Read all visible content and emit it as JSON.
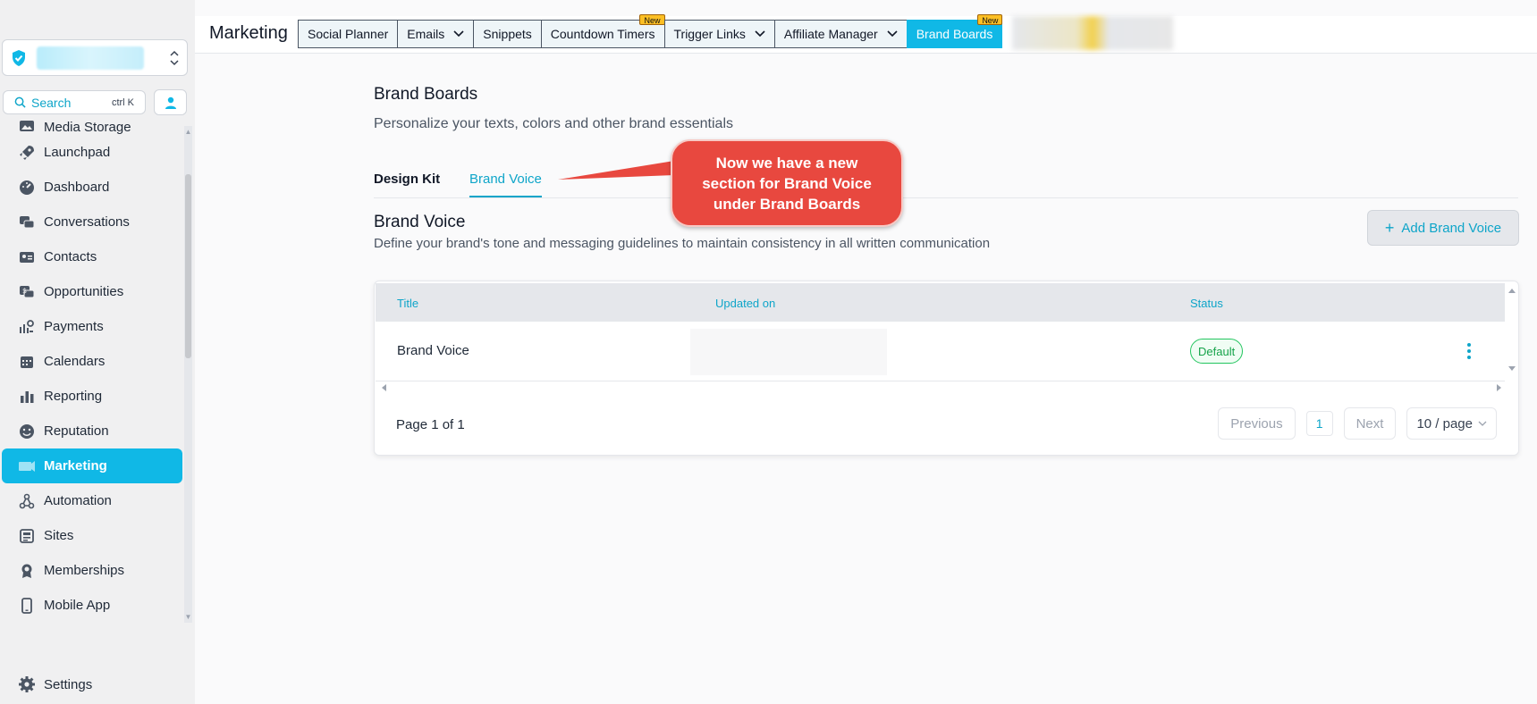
{
  "sidebar": {
    "search": {
      "label": "Search",
      "shortcut": "ctrl K"
    },
    "items": [
      {
        "label": "Media Storage",
        "icon": "image-icon",
        "active": false
      },
      {
        "label": "Launchpad",
        "icon": "rocket-icon",
        "active": false
      },
      {
        "label": "Dashboard",
        "icon": "gauge-icon",
        "active": false
      },
      {
        "label": "Conversations",
        "icon": "chat-icon",
        "active": false
      },
      {
        "label": "Contacts",
        "icon": "contact-card-icon",
        "active": false
      },
      {
        "label": "Opportunities",
        "icon": "dollar-chat-icon",
        "active": false
      },
      {
        "label": "Payments",
        "icon": "payments-icon",
        "active": false
      },
      {
        "label": "Calendars",
        "icon": "calendar-icon",
        "active": false
      },
      {
        "label": "Reporting",
        "icon": "bar-chart-icon",
        "active": false
      },
      {
        "label": "Reputation",
        "icon": "smiley-icon",
        "active": false
      },
      {
        "label": "Marketing",
        "icon": "megaphone-icon",
        "active": true
      },
      {
        "label": "Automation",
        "icon": "automation-icon",
        "active": false
      },
      {
        "label": "Sites",
        "icon": "sites-icon",
        "active": false
      },
      {
        "label": "Memberships",
        "icon": "badge-icon",
        "active": false
      },
      {
        "label": "Mobile App",
        "icon": "mobile-icon",
        "active": false
      }
    ],
    "settings_label": "Settings"
  },
  "topbar": {
    "module_title": "Marketing",
    "tabs": [
      {
        "label": "Social Planner",
        "dropdown": false,
        "badge": "",
        "active": false
      },
      {
        "label": "Emails",
        "dropdown": true,
        "badge": "",
        "active": false
      },
      {
        "label": "Snippets",
        "dropdown": false,
        "badge": "",
        "active": false
      },
      {
        "label": "Countdown Timers",
        "dropdown": false,
        "badge": "New",
        "active": false
      },
      {
        "label": "Trigger Links",
        "dropdown": true,
        "badge": "",
        "active": false
      },
      {
        "label": "Affiliate Manager",
        "dropdown": true,
        "badge": "",
        "active": false
      },
      {
        "label": "Brand Boards",
        "dropdown": false,
        "badge": "New",
        "active": true
      }
    ]
  },
  "page": {
    "title": "Brand Boards",
    "subtitle": "Personalize your texts, colors and other brand essentials",
    "subtabs": [
      "Design Kit",
      "Brand Voice"
    ],
    "section": {
      "title": "Brand Voice",
      "description": "Define your brand's tone and messaging guidelines to maintain consistency in all written communication",
      "add_button": "Add Brand Voice"
    },
    "table": {
      "columns": [
        "Title",
        "Updated on",
        "Status"
      ],
      "rows": [
        {
          "title": "Brand Voice",
          "status": "Default"
        }
      ],
      "pagination": {
        "summary": "Page 1 of 1",
        "previous": "Previous",
        "current": "1",
        "next": "Next",
        "per_page": "10 / page"
      }
    }
  },
  "callout": {
    "text": "Now we have a new section for Brand Voice under Brand Boards"
  },
  "colors": {
    "accent": "#10b8e6",
    "callout": "#e8483f",
    "status_default": "#16a34a"
  }
}
